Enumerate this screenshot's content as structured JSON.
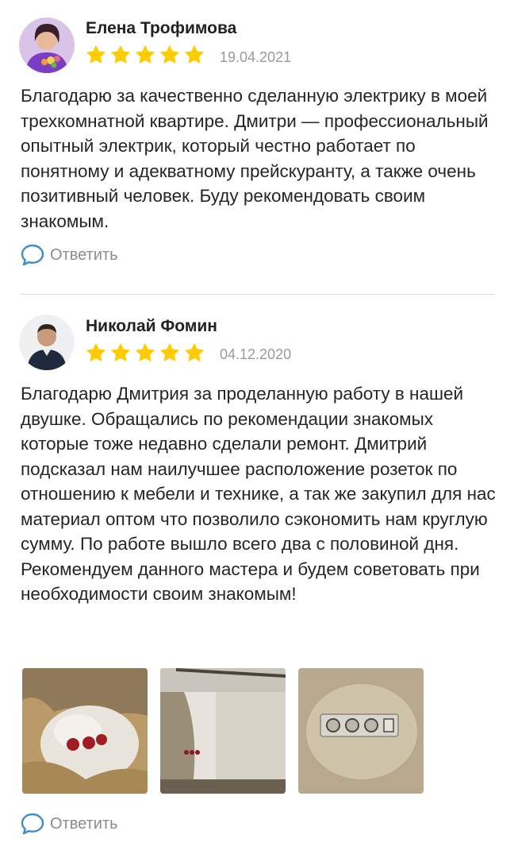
{
  "reviews": [
    {
      "author": "Елена Трофимова",
      "rating": 5,
      "date": "19.04.2021",
      "text": "Благодарю за качественно сделанную электрику в моей трехкомнатной квартире. Дмитри — профессиональный опытный электрик, который честно работает по понятному и адекватному прейскуранту, а также очень позитивный человек. Буду рекомендовать своим знакомым.",
      "reply_label": "Ответить"
    },
    {
      "author": "Николай Фомин",
      "rating": 5,
      "date": "04.12.2020",
      "text": "Благодарю Дмитрия за проделанную работу в нашей двушке. Обращались по рекомендации знакомых которые тоже недавно сделали ремонт. Дмитрий подсказал нам наилучшее расположение розеток по отношению к мебели и технике, а так же закупил для нас материал оптом что позволило сэкономить нам круглую сумму. По работе вышло всего два с половиной дня. Рекомендуем данного мастера и будем советовать при необходимости своим знакомым!",
      "reply_label": "Ответить",
      "photos": [
        "photo-1",
        "photo-2",
        "photo-3"
      ]
    }
  ],
  "colors": {
    "star": "#ffcc00",
    "date": "#9a9a9a",
    "reply": "#8c8c8c",
    "divider": "#dcdcdc"
  },
  "icons": {
    "reply": "speech-bubble-icon",
    "rating": "star-icon"
  }
}
